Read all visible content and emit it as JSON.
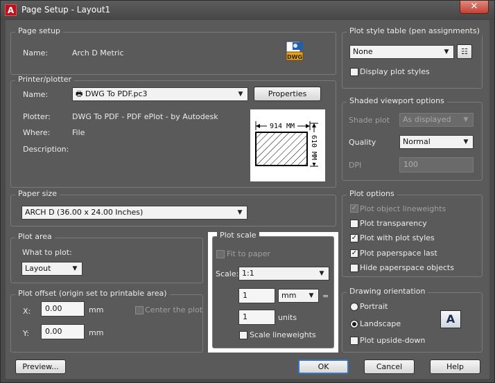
{
  "window": {
    "title": "Page Setup - Layout1",
    "close": "✕"
  },
  "page_setup": {
    "legend": "Page setup",
    "name_label": "Name:",
    "name_value": "Arch D Metric",
    "icon_text": "DWG"
  },
  "printer": {
    "legend": "Printer/plotter",
    "name_label": "Name:",
    "name_value": "DWG To PDF.pc3",
    "properties_label": "Properties",
    "plotter_label": "Plotter:",
    "plotter_value": "DWG To PDF - PDF ePlot - by Autodesk",
    "where_label": "Where:",
    "where_value": "File",
    "description_label": "Description:",
    "preview_width": "914  MM",
    "preview_height": "610  MM"
  },
  "paper_size": {
    "legend": "Paper size",
    "value": "ARCH D (36.00 x 24.00 Inches)"
  },
  "plot_area": {
    "legend": "Plot area",
    "what_label": "What to plot:",
    "what_value": "Layout"
  },
  "plot_offset": {
    "legend": "Plot offset (origin set to printable area)",
    "x_label": "X:",
    "x_value": "0.00",
    "x_unit": "mm",
    "y_label": "Y:",
    "y_value": "0.00",
    "y_unit": "mm",
    "center_label": "Center the plot"
  },
  "plot_scale": {
    "legend": "Plot scale",
    "fit_label": "Fit to paper",
    "scale_label": "Scale:",
    "scale_value": "1:1",
    "value1": "1",
    "unit_value": "mm",
    "equals": "=",
    "value2": "1",
    "units_label": "units",
    "scale_lw_label": "Scale lineweights"
  },
  "plot_style": {
    "legend": "Plot style table (pen assignments)",
    "value": "None",
    "display_label": "Display plot styles"
  },
  "shaded": {
    "legend": "Shaded viewport options",
    "shade_label": "Shade plot",
    "shade_value": "As displayed",
    "quality_label": "Quality",
    "quality_value": "Normal",
    "dpi_label": "DPI",
    "dpi_value": "100"
  },
  "plot_options": {
    "legend": "Plot options",
    "items": [
      {
        "label": "Plot object lineweights",
        "checked": true,
        "disabled": true
      },
      {
        "label": "Plot transparency",
        "checked": false,
        "disabled": false
      },
      {
        "label": "Plot with plot styles",
        "checked": true,
        "disabled": false
      },
      {
        "label": "Plot paperspace last",
        "checked": true,
        "disabled": false
      },
      {
        "label": "Hide paperspace objects",
        "checked": false,
        "disabled": false
      }
    ]
  },
  "orientation": {
    "legend": "Drawing orientation",
    "portrait": "Portrait",
    "landscape": "Landscape",
    "upside_down": "Plot upside-down",
    "icon_letter": "A"
  },
  "footer": {
    "preview": "Preview...",
    "ok": "OK",
    "cancel": "Cancel",
    "help": "Help"
  }
}
